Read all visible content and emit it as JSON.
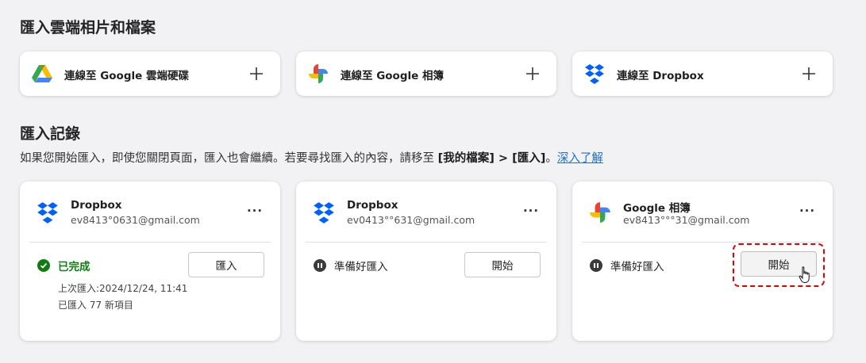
{
  "sections": {
    "import_cloud_title": "匯入雲端相片和檔案",
    "history_title": "匯入記錄"
  },
  "connect_cards": [
    {
      "label": "連線至 Google 雲端硬碟",
      "icon": "google-drive-icon"
    },
    {
      "label": "連線至 Google 相簿",
      "icon": "google-photos-icon"
    },
    {
      "label": "連線至 Dropbox",
      "icon": "dropbox-icon"
    }
  ],
  "description": {
    "text_before": "如果您開始匯入，即使您關閉頁面，匯入也會繼續。若要尋找匯入的內容，請移至 ",
    "bold1": "[我的檔案]",
    "sep": " > ",
    "bold2": "[匯入]",
    "text_after": "。",
    "link": "深入了解"
  },
  "history_cards": [
    {
      "service": "Dropbox",
      "email": "ev8413°0631@gmail.com",
      "status": "已完成",
      "button": "匯入",
      "last_import": "上次匯入:2024/12/24, 11:41",
      "imported_items": "已匯入 77 新項目",
      "icon": "dropbox-icon"
    },
    {
      "service": "Dropbox",
      "email": "ev0413°°631@gmail.com",
      "status": "準備好匯入",
      "button": "開始",
      "icon": "dropbox-icon"
    },
    {
      "service": "Google 相簿",
      "email": "ev8413°°°31@gmail.com",
      "status": "準備好匯入",
      "button": "開始",
      "icon": "google-photos-icon"
    }
  ],
  "more_label": "···",
  "colors": {
    "accent_link": "#1f6fc7",
    "success": "#107c10",
    "highlight": "#e00000",
    "dropbox": "#0061fe"
  }
}
